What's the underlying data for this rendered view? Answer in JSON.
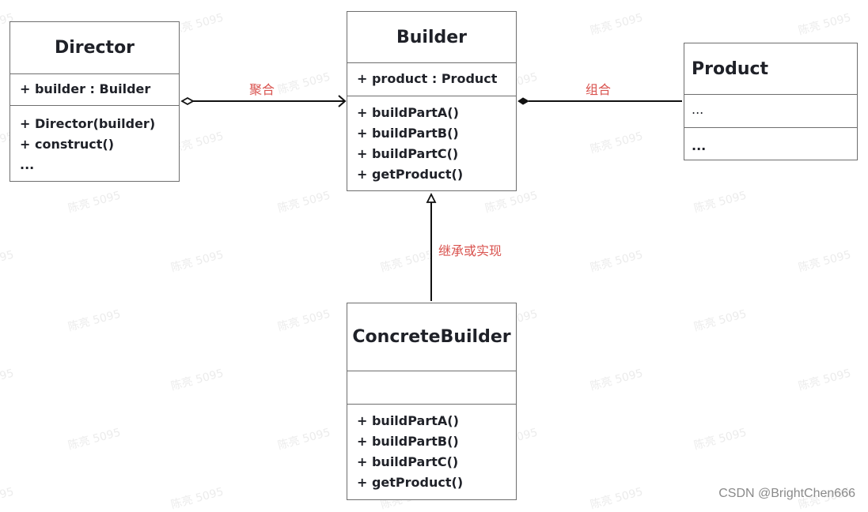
{
  "classes": {
    "director": {
      "name": "Director",
      "attributes": [
        "+ builder : Builder"
      ],
      "operations": [
        "+ Director(builder)",
        "+ construct()",
        "..."
      ]
    },
    "builder": {
      "name": "Builder",
      "attributes": [
        "+ product : Product"
      ],
      "operations": [
        "+ buildPartA()",
        "+ buildPartB()",
        "+ buildPartC()",
        "+ getProduct()"
      ]
    },
    "product": {
      "name": "Product",
      "attributes": [
        "..."
      ],
      "operations": [
        "..."
      ]
    },
    "concrete_builder": {
      "name": "ConcreteBuilder",
      "attributes": [],
      "operations": [
        "+ buildPartA()",
        "+ buildPartB()",
        "+ buildPartC()",
        "+ getProduct()"
      ]
    }
  },
  "relations": {
    "aggregation": {
      "label": "聚合",
      "from": "Director",
      "to": "Builder",
      "type": "aggregation"
    },
    "composition": {
      "label": "组合",
      "from": "Builder",
      "to": "Product",
      "type": "composition"
    },
    "inheritance": {
      "label": "继承或实现",
      "from": "ConcreteBuilder",
      "to": "Builder",
      "type": "generalization"
    }
  },
  "label_color": "#d9534f",
  "watermark": "陈亮 5095",
  "credit": "CSDN @BrightChen666"
}
